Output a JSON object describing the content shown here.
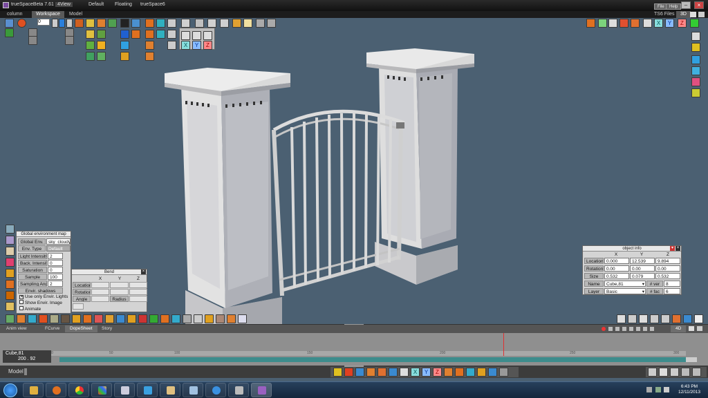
{
  "titlebar": {
    "app_title": "trueSpaceBeta 7.61",
    "layouts": [
      "4View",
      "Default",
      "Floating",
      "trueSpace6"
    ],
    "file_label": "File",
    "help_label": "Help"
  },
  "menu": {
    "tabs": [
      "column",
      "Workspace",
      "Model"
    ],
    "ts6_files": "TS6 Files",
    "view_3d": "3D"
  },
  "toolbar": {
    "frame_value": "0"
  },
  "env_panel": {
    "title": "Global environment map",
    "global_env_label": "Global Env.",
    "global_env_value": "sky_cloudy",
    "env_type_label": "Env. Type",
    "env_type_value": "Default",
    "rows": [
      {
        "label": "Light Intensity",
        "value": "2"
      },
      {
        "label": "Back. Intensity",
        "value": "0"
      },
      {
        "label": "Saturation",
        "value": "0"
      },
      {
        "label": "Sample",
        "value": "100"
      },
      {
        "label": "Sampling Angle",
        "value": "2"
      }
    ],
    "envir_shadows": "Envir. shadows",
    "checks": [
      {
        "label": "Use only Envir. Lights",
        "checked": true
      },
      {
        "label": "Show Envir. Image",
        "checked": false
      },
      {
        "label": "Animate",
        "checked": false
      }
    ]
  },
  "bend_panel": {
    "title": "Bend",
    "cols": [
      "X",
      "Y",
      "Z"
    ],
    "rows": [
      "Location",
      "Rotation",
      "Angle"
    ],
    "radius_label": "Radius"
  },
  "object_info": {
    "title": "object info",
    "cols": [
      "X",
      "Y",
      "Z"
    ],
    "rows": [
      {
        "label": "Location",
        "values": [
          "0.000",
          "12.539",
          "9.894"
        ]
      },
      {
        "label": "Rotation",
        "values": [
          "0.00",
          "0.00",
          "0.00"
        ]
      },
      {
        "label": "Size",
        "values": [
          "0.532",
          "0.079",
          "0.532"
        ]
      }
    ],
    "name_label": "Name",
    "name_value": "Cube,81",
    "ver_label": "# ver",
    "ver_value": "8",
    "layer_label": "Layer",
    "layer_value": "Basic",
    "fac_label": "# fac",
    "fac_value": "6"
  },
  "anim_view": {
    "title": "Anim view",
    "tabs": [
      "FCurve",
      "DopeSheet",
      "Story"
    ],
    "view_4d": "4D",
    "object_name": "Cube,81",
    "range_label": "200 . 92",
    "ticks": [
      "0",
      "50",
      "100",
      "150",
      "200",
      "250",
      "300"
    ]
  },
  "model_label": "Model",
  "taskbar": {
    "time": "6:43 PM",
    "date": "12/11/2013"
  },
  "colors": {
    "viewport_bg": "#4b6072",
    "track_teal": "#3d8c8c",
    "playhead": "#e03030"
  }
}
